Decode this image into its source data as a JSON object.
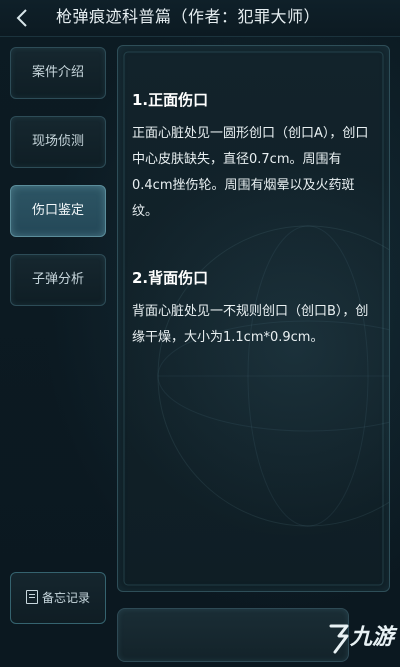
{
  "header": {
    "back_icon": "chevron-left-icon",
    "title": "枪弹痕迹科普篇（作者：犯罪大师）"
  },
  "sidebar": {
    "tabs": [
      {
        "label": "案件介绍",
        "active": false
      },
      {
        "label": "现场侦测",
        "active": false
      },
      {
        "label": "伤口鉴定",
        "active": true
      },
      {
        "label": "子弹分析",
        "active": false
      }
    ],
    "notes_button": {
      "icon": "notebook-icon",
      "label": "备忘记录"
    }
  },
  "content": {
    "sections": [
      {
        "title": "1.正面伤口",
        "text": "正面心脏处见一圆形创口（创口A），创口中心皮肤缺失，直径0.7cm。周围有0.4cm挫伤轮。周围有烟晕以及火药斑纹。"
      },
      {
        "title": "2.背面伤口",
        "text": "背面心脏处见一不规则创口（创口B），创缘干燥，大小为1.1cm*0.9cm。"
      }
    ]
  },
  "watermark": {
    "icon": "jiuyou-logo-icon",
    "text": "九游"
  },
  "colors": {
    "background": "#0b1a22",
    "active_tab": "#2d5564",
    "panel_border": "#2e4e58",
    "text": "#e9f0f2"
  }
}
